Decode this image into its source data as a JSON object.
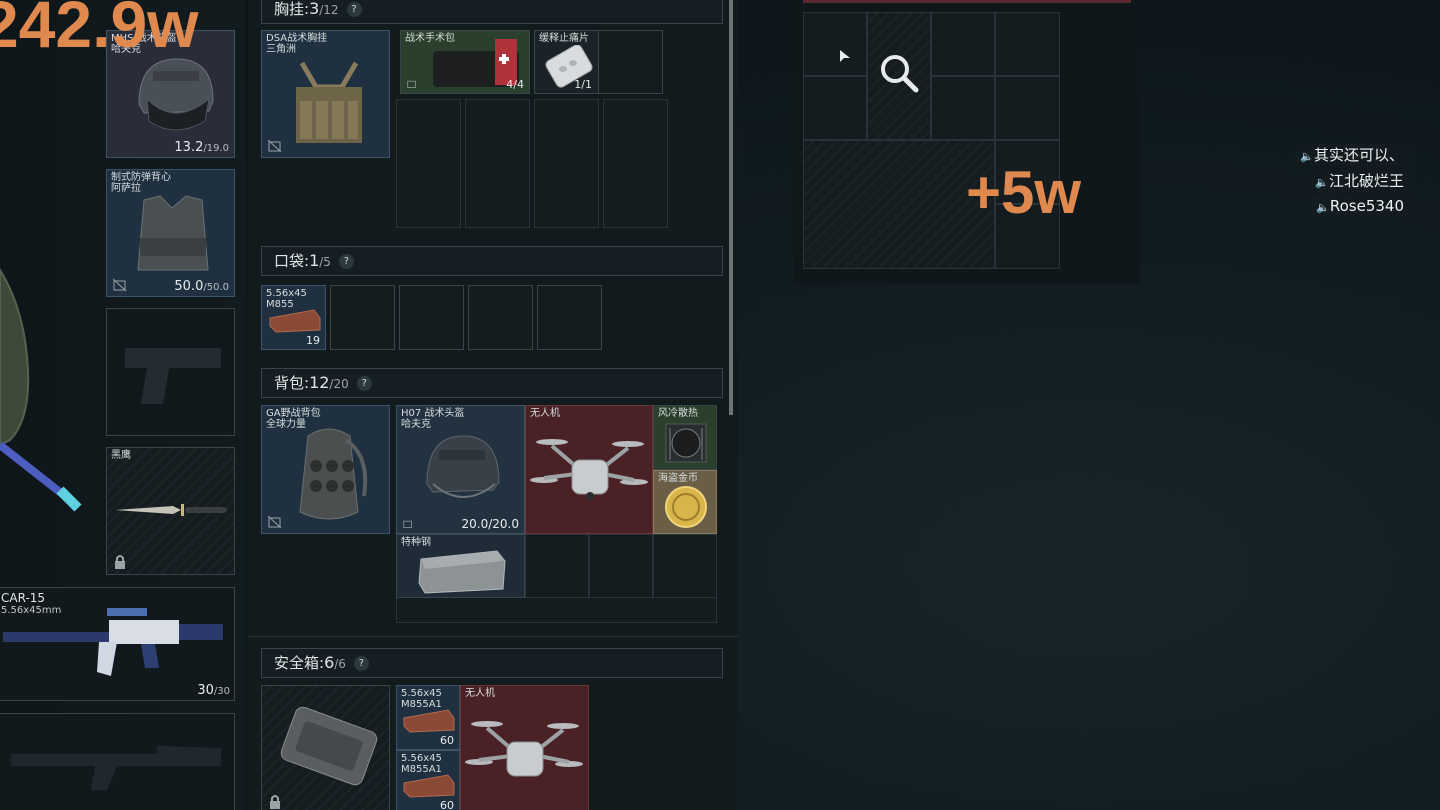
{
  "overlays": {
    "total_value": "242.9w",
    "gain_value": "+5w"
  },
  "loadout": {
    "helmet": {
      "label": "MHS 战术头盔\n哈夫克",
      "durability": "13.2",
      "max": "/19.0"
    },
    "armor": {
      "label": "制式防弹背心\n阿萨拉",
      "durability": "50.0",
      "max": "/50.0"
    },
    "melee": {
      "label": "黑鹰"
    },
    "rifle": {
      "name": "CAR-15",
      "caliber": "5.56x45mm",
      "ammo": "30",
      "ammo_max": "/30"
    }
  },
  "chest_rig": {
    "title": "胸挂:",
    "count": "3",
    "max": "/12",
    "rig_item": {
      "label": "DSA战术胸挂\n三角洲"
    },
    "items": [
      {
        "label": "战术手术包",
        "count": "4/4"
      },
      {
        "label": "缓释止痛片",
        "count": "1/1"
      }
    ]
  },
  "pocket": {
    "title": "口袋:",
    "count": "1",
    "max": "/5",
    "items": [
      {
        "label": "5.56x45\nM855",
        "count": "19"
      }
    ]
  },
  "backpack": {
    "title": "背包:",
    "count": "12",
    "max": "/20",
    "bag_item": {
      "label": "GA野战背包\n全球力量"
    },
    "items": [
      {
        "label": "H07 战术头盔\n哈夫克",
        "count": "20.0/20.0"
      },
      {
        "label": "无人机"
      },
      {
        "label": "风冷散热"
      },
      {
        "label": "海盗金币"
      },
      {
        "label": "特种钢"
      }
    ]
  },
  "safe_box": {
    "title": "安全箱:",
    "count": "6",
    "max": "/6",
    "items": [
      {
        "label": "5.56x45\nM855A1",
        "count": "60"
      },
      {
        "label": "5.56x45\nM855A1",
        "count": "60"
      },
      {
        "label": "无人机"
      }
    ]
  },
  "voice_chat": [
    "其实还可以、",
    "江北破烂王",
    "Rose5340"
  ],
  "colors": {
    "accent_orange": "#e0894f",
    "drone_red": "#4a2226",
    "coin_gold": "#6a5e47"
  }
}
